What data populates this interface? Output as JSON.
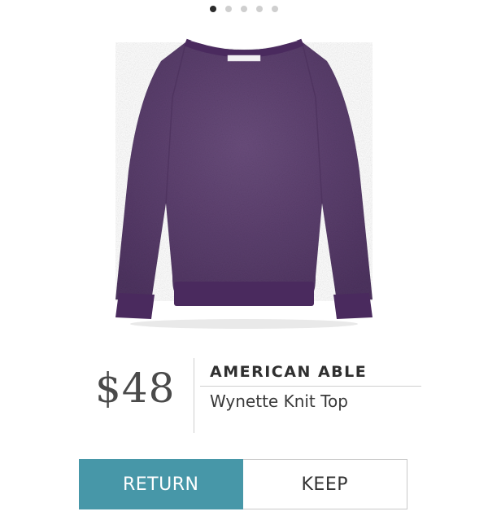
{
  "carousel": {
    "slide_count": 5,
    "active_index": 0
  },
  "product": {
    "image_icon": "purple-sweater-image",
    "price": "$48",
    "brand": "AMERICAN ABLE",
    "name": "Wynette Knit Top"
  },
  "actions": {
    "return_label": "RETURN",
    "keep_label": "KEEP"
  },
  "colors": {
    "accent": "#4797a8",
    "sweater": "#5a3d6a",
    "rib": "#4a2a5e"
  }
}
